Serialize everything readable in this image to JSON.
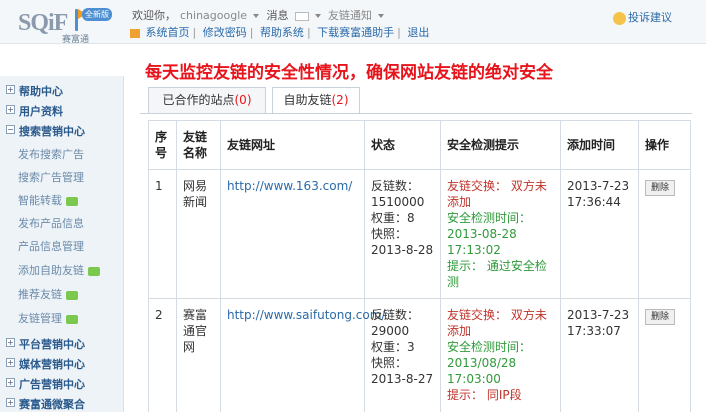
{
  "header": {
    "logo_text": "SQiF",
    "logo_sub": "赛富通",
    "version_badge": "全新版",
    "welcome": "欢迎你，",
    "username": "chinagoogle",
    "messages_label": "消息",
    "friend_notice_label": "友链通知",
    "feedback_label": "投诉建议",
    "nav": [
      "系统首页",
      "修改密码",
      "帮助系统",
      "下载赛富通助手",
      "退出"
    ]
  },
  "sidebar": {
    "items": [
      {
        "label": "帮助中心",
        "type": "top",
        "marker": "+"
      },
      {
        "label": "用户资料",
        "type": "top",
        "marker": "+"
      },
      {
        "label": "搜索营销中心",
        "type": "top",
        "marker": "−"
      },
      {
        "label": "发布搜索广告",
        "type": "sub",
        "tag": false
      },
      {
        "label": "搜索广告管理",
        "type": "sub",
        "tag": false
      },
      {
        "label": "智能转载",
        "type": "sub",
        "tag": true
      },
      {
        "label": "发布产品信息",
        "type": "sub",
        "tag": false
      },
      {
        "label": "产品信息管理",
        "type": "sub",
        "tag": false
      },
      {
        "label": "添加自助友链",
        "type": "sub",
        "tag": true
      },
      {
        "label": "推荐友链",
        "type": "sub",
        "tag": true
      },
      {
        "label": "友链管理",
        "type": "sub",
        "tag": true
      },
      {
        "label": "平台营销中心",
        "type": "top",
        "marker": "+"
      },
      {
        "label": "媒体营销中心",
        "type": "top",
        "marker": "+"
      },
      {
        "label": "广告营销中心",
        "type": "top",
        "marker": "+"
      },
      {
        "label": "赛富通微聚合",
        "type": "top",
        "marker": "+"
      }
    ]
  },
  "main": {
    "headline": "每天监控友链的安全性情况，确保网站友链的绝对安全",
    "tabs": [
      {
        "label": "已合作的站点",
        "count": "(0)",
        "active": false
      },
      {
        "label": "自助友链",
        "count": "(2)",
        "active": true
      }
    ],
    "columns": [
      "序号",
      "友链名称",
      "友链网址",
      "状态",
      "安全检测提示",
      "添加时间",
      "操作"
    ],
    "rows": [
      {
        "no": "1",
        "name": "网易新闻",
        "url": "http://www.163.com/",
        "status": [
          "反链数：",
          "1510000",
          "权重：8",
          "快照：",
          "2013-8-28"
        ],
        "check_warn": "友链交换： 双方未添加",
        "check_time_label": "安全检测时间：",
        "check_time": "2013-08-28 17:13:02",
        "check_tip": "提示： 通过安全检测",
        "added": "2013-7-23 17:36:44",
        "action": "删除"
      },
      {
        "no": "2",
        "name": "赛富通官网",
        "url": "http://www.saifutong.com/",
        "status": [
          "反链数：",
          "29000",
          "权重：3",
          "快照：",
          "2013-8-27"
        ],
        "check_warn": "友链交换： 双方未添加",
        "check_time_label": "安全检测时间：",
        "check_time": "2013/08/28 17:03:00",
        "check_tip": "提示： 同IP段",
        "added": "2013-7-23 17:33:07",
        "action": "删除"
      }
    ]
  },
  "colors": {
    "headline": "#e8141c",
    "link": "#2a6aa8",
    "warn": "#c0332b",
    "ok": "#2f9a3a"
  }
}
